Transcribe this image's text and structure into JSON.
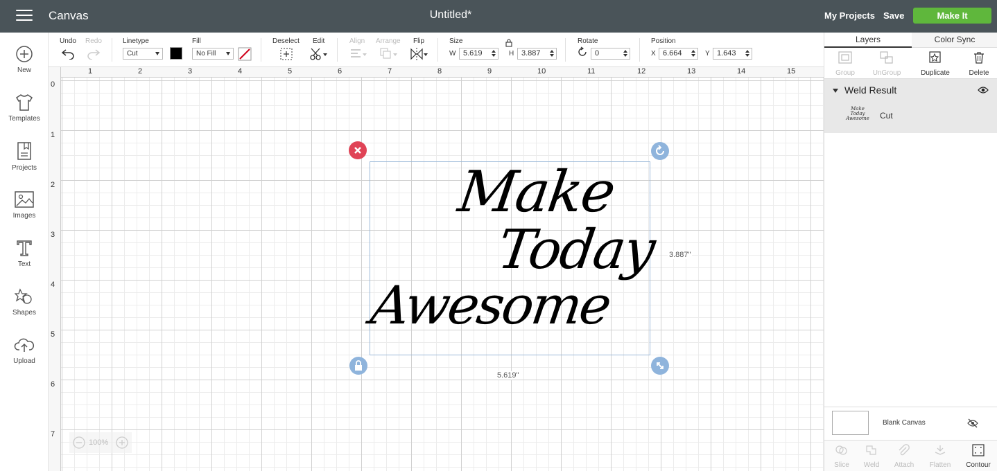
{
  "header": {
    "app_name": "Canvas",
    "doc_title": "Untitled*",
    "my_projects": "My Projects",
    "save": "Save",
    "make_it": "Make It"
  },
  "sidebar": {
    "items": [
      {
        "label": "New",
        "icon": "plus-circle-icon"
      },
      {
        "label": "Templates",
        "icon": "tshirt-icon"
      },
      {
        "label": "Projects",
        "icon": "bookmark-icon"
      },
      {
        "label": "Images",
        "icon": "image-icon"
      },
      {
        "label": "Text",
        "icon": "text-icon"
      },
      {
        "label": "Shapes",
        "icon": "shapes-icon"
      },
      {
        "label": "Upload",
        "icon": "upload-cloud-icon"
      }
    ]
  },
  "toolbar": {
    "undo": "Undo",
    "redo": "Redo",
    "linetype_label": "Linetype",
    "linetype_value": "Cut",
    "fill_label": "Fill",
    "fill_value": "No Fill",
    "deselect": "Deselect",
    "edit": "Edit",
    "align": "Align",
    "arrange": "Arrange",
    "flip": "Flip",
    "size_label": "Size",
    "w_label": "W",
    "w_value": "5.619",
    "h_label": "H",
    "h_value": "3.887",
    "rotate_label": "Rotate",
    "rotate_value": "0",
    "position_label": "Position",
    "x_label": "X",
    "x_value": "6.664",
    "y_label": "Y",
    "y_value": "1.643",
    "swatch_color": "#000000"
  },
  "canvas": {
    "ruler_top": [
      "1",
      "2",
      "3",
      "4",
      "5",
      "6",
      "7",
      "8",
      "9",
      "10",
      "11",
      "12",
      "13",
      "14",
      "15"
    ],
    "ruler_left": [
      "0",
      "1",
      "2",
      "3",
      "4",
      "5",
      "6",
      "7"
    ],
    "artwork_lines": [
      "Make",
      "Today",
      "Awesome"
    ],
    "width_dim": "5.619\"",
    "height_dim": "3.887\"",
    "zoom": "100%",
    "delete_color": "#e04356",
    "handle_color": "#8fb4dc"
  },
  "right_panel": {
    "tabs": [
      "Layers",
      "Color Sync"
    ],
    "tools": [
      "Group",
      "UnGroup",
      "Duplicate",
      "Delete"
    ],
    "group_name": "Weld Result",
    "layer_name": "Cut",
    "thumb_text": "Make Today Awesome",
    "blank_canvas": "Blank Canvas",
    "bottom_tools": [
      "Slice",
      "Weld",
      "Attach",
      "Flatten",
      "Contour"
    ]
  }
}
